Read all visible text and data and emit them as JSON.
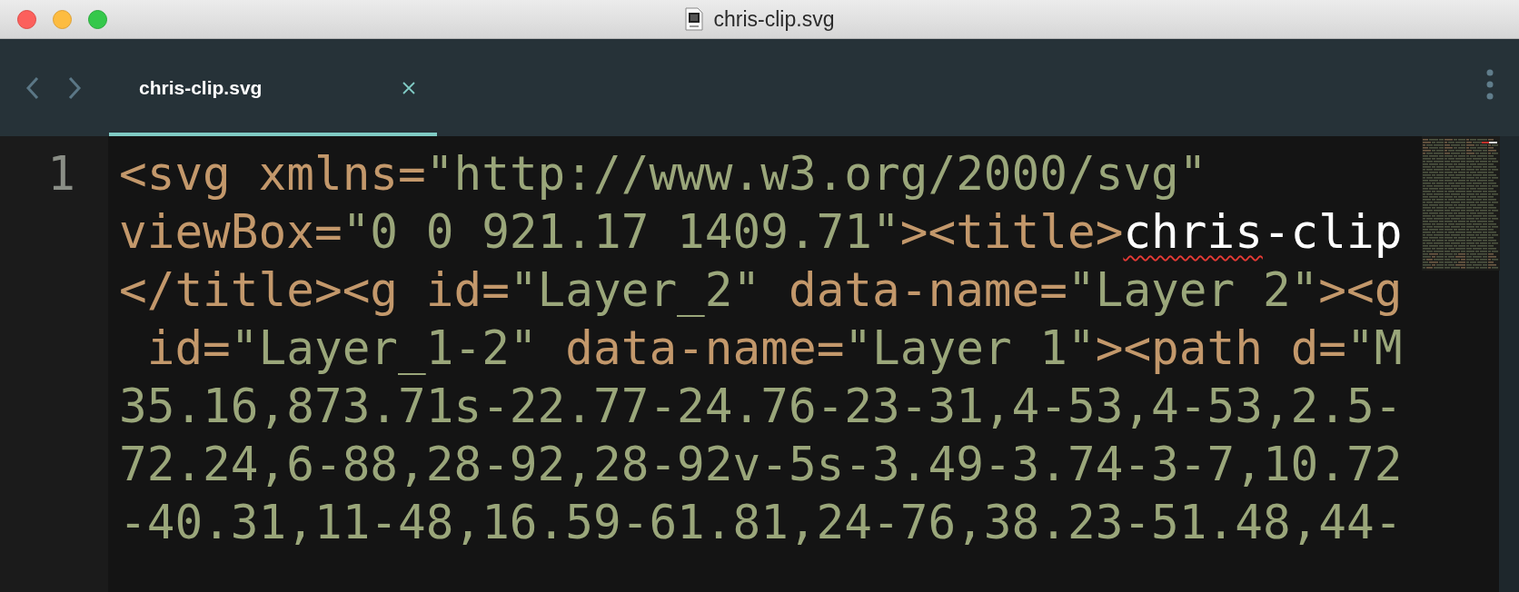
{
  "window": {
    "title": "chris-clip.svg"
  },
  "nav": [
    {
      "kind": "back"
    },
    {
      "kind": "forward"
    }
  ],
  "tabs": [
    {
      "label": "chris-clip.svg",
      "selected": true
    }
  ],
  "editor": {
    "line_numbers": [
      "1"
    ],
    "rows": [
      {
        "segments": [
          {
            "kind": "tag",
            "text": "<svg"
          },
          {
            "kind": "tag",
            "text": " xmlns="
          },
          {
            "kind": "string",
            "text": "\"http://www.w3.org/2000/svg\""
          }
        ]
      },
      {
        "segments": [
          {
            "kind": "tag",
            "text": "viewBox="
          },
          {
            "kind": "string",
            "text": "\"0 0 921.17 1409.71\""
          },
          {
            "kind": "tag",
            "text": "><title>"
          },
          {
            "kind": "text",
            "text": "chris",
            "misspelled": true
          },
          {
            "kind": "text",
            "text": "-clip",
            "misspelled": false
          }
        ]
      },
      {
        "segments": [
          {
            "kind": "tag",
            "text": "</title><g"
          },
          {
            "kind": "tag",
            "text": " id="
          },
          {
            "kind": "string",
            "text": "\"Layer_2\""
          },
          {
            "kind": "tag",
            "text": " data-name="
          },
          {
            "kind": "string",
            "text": "\"Layer 2\""
          },
          {
            "kind": "tag",
            "text": "><g"
          }
        ]
      },
      {
        "segments": [
          {
            "kind": "tag",
            "text": " id="
          },
          {
            "kind": "string",
            "text": "\"Layer_1-2\""
          },
          {
            "kind": "tag",
            "text": " data-name="
          },
          {
            "kind": "string",
            "text": "\"Layer 1\""
          },
          {
            "kind": "tag",
            "text": "><path d="
          },
          {
            "kind": "string",
            "text": "\"M"
          }
        ]
      },
      {
        "segments": [
          {
            "kind": "string",
            "text": "35.16,873.71s-22.77-24.76-23-31,4-53,4-53,2.5-"
          }
        ]
      },
      {
        "segments": [
          {
            "kind": "string",
            "text": "72.24,6-88,28-92,28-92v-5s-3.49-3.74-3-7,10.72"
          }
        ]
      },
      {
        "segments": [
          {
            "kind": "string",
            "text": "-40.31,11-48,16.59-61.81,24-76,38.23-51.48,44-"
          }
        ]
      }
    ]
  }
}
